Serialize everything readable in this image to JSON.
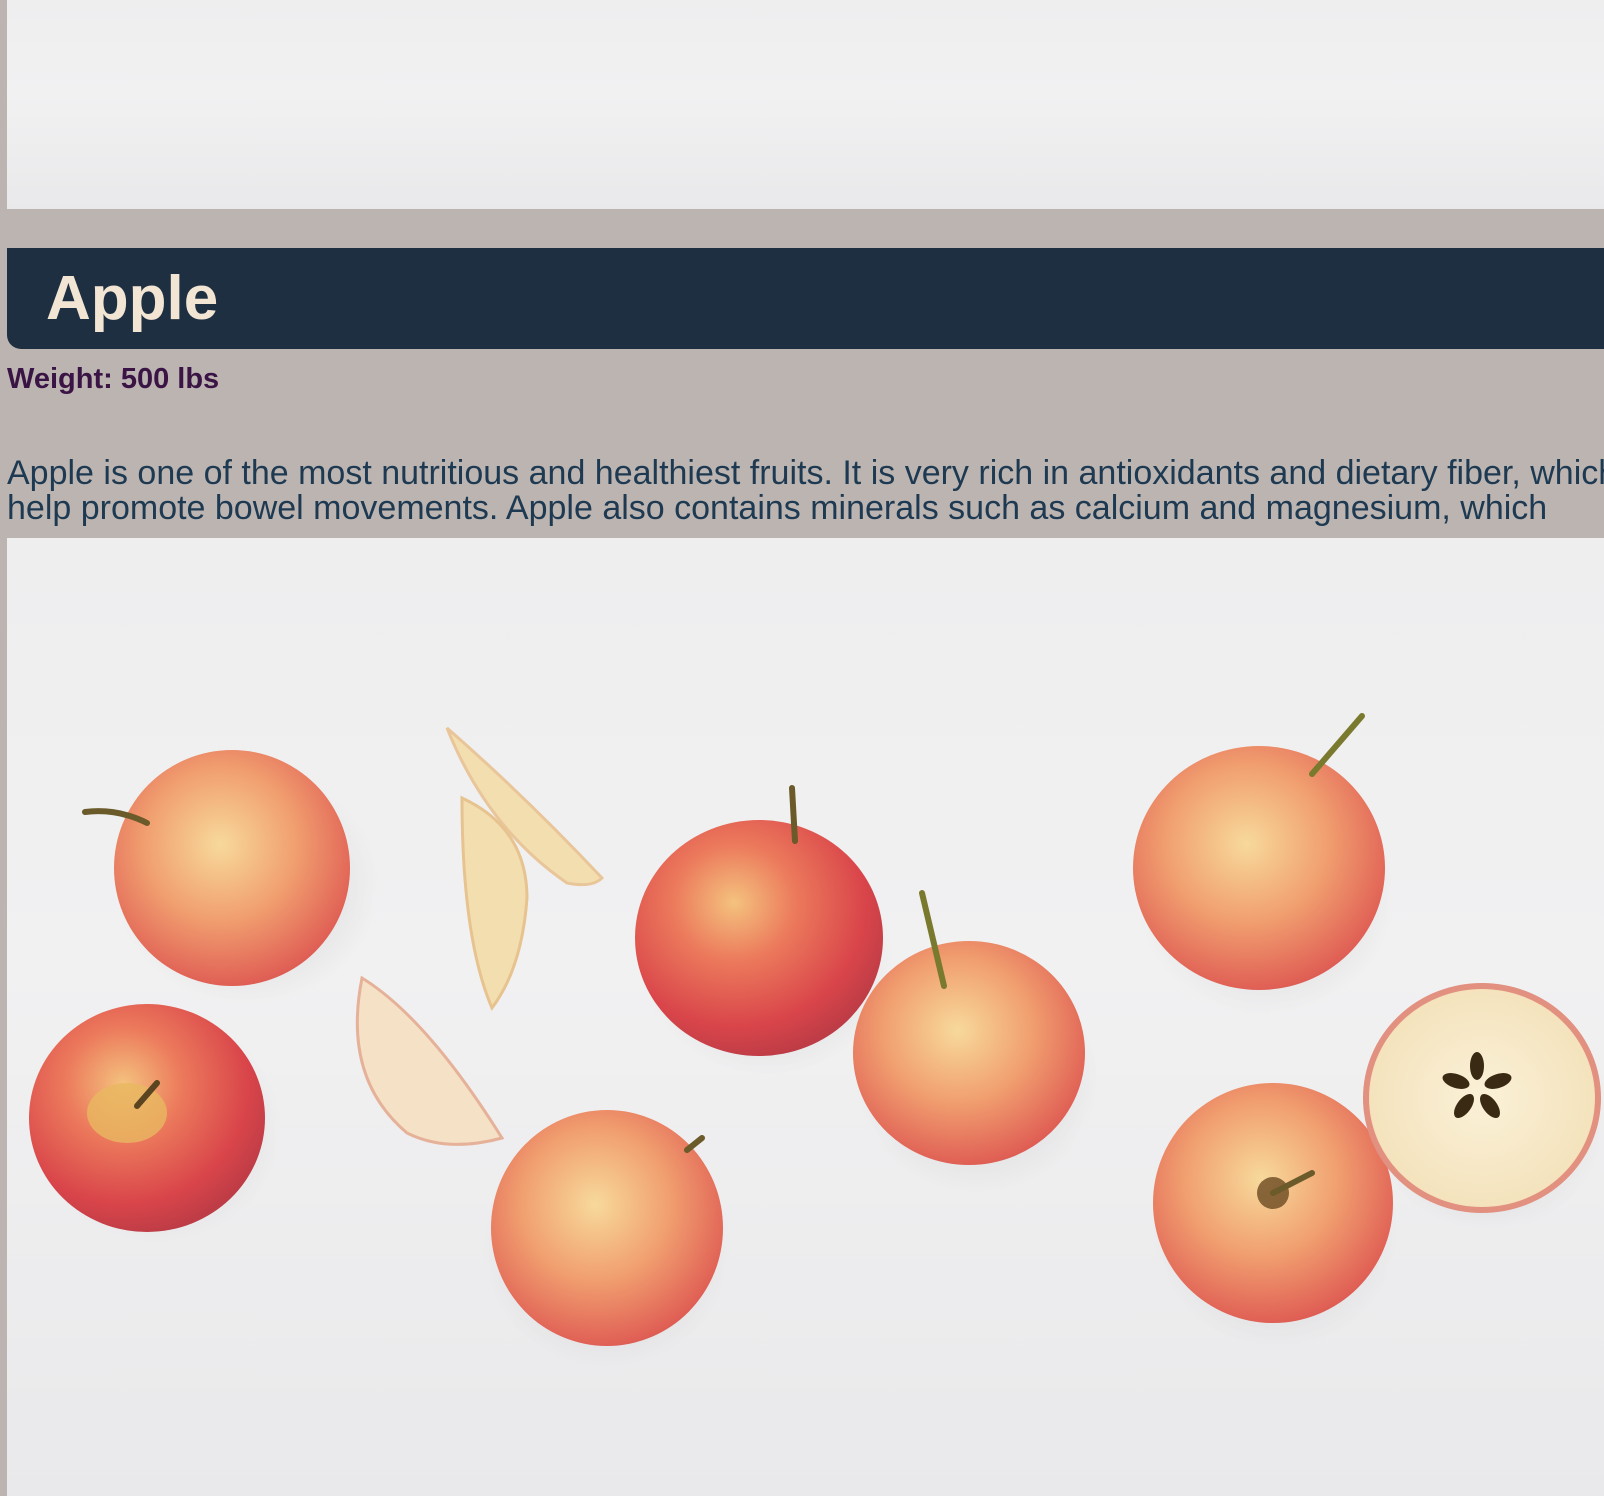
{
  "product": {
    "name": "Apple",
    "weight": "Weight: 500 lbs",
    "description": "Apple is one of the most nutritious and healthiest fruits. It is very rich in antioxidants and dietary fiber, which help promote bowel movements. Apple also contains minerals such as calcium and magnesium, which",
    "image_alt": "Red and yellow apples with slices on a white wooden surface"
  },
  "colors": {
    "page_background": "#bcb4b0",
    "title_bar": "#1e2f42",
    "title_text": "#f2e5d3",
    "weight_text": "#3b1446",
    "description_text": "#1e3a52"
  }
}
